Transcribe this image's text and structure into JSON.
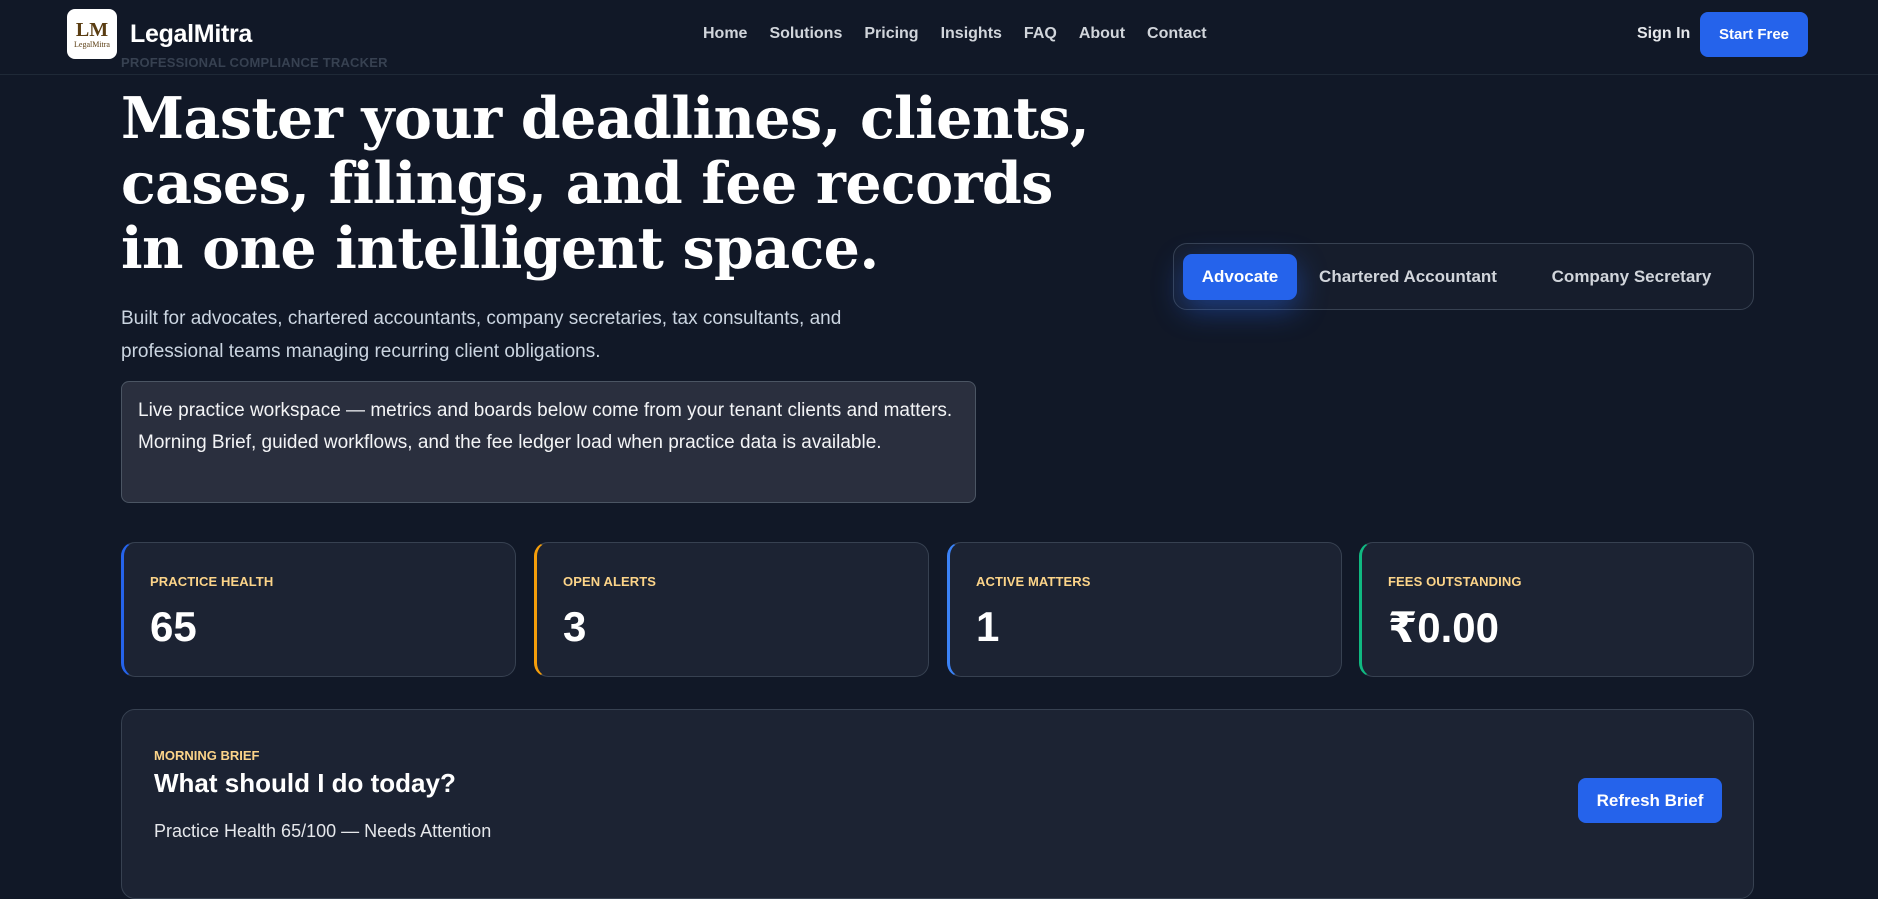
{
  "brand": {
    "name": "LegalMitra",
    "logo_mark": "LM",
    "logo_caption": "LegalMitra"
  },
  "nav": [
    "Home",
    "Solutions",
    "Pricing",
    "Insights",
    "FAQ",
    "About",
    "Contact"
  ],
  "auth": {
    "sign_in": "Sign In",
    "start": "Start Free"
  },
  "hero": {
    "eyebrow": "PROFESSIONAL COMPLIANCE TRACKER",
    "title": "Master your deadlines, clients, cases, filings, and fee records in one intelligent space.",
    "subtitle": "Built for advocates, chartered accountants, company secretaries, tax consultants, and professional teams managing recurring client obligations.",
    "notice": "Live practice workspace — metrics and boards below come from your tenant clients and matters. Morning Brief, guided workflows, and the fee ledger load when practice data is available."
  },
  "roles": {
    "active": "Advocate",
    "items": [
      "Advocate",
      "Chartered Accountant",
      "Company Secretary"
    ]
  },
  "stats": [
    {
      "label": "PRACTICE HEALTH",
      "value": "65",
      "accent": "#2563eb"
    },
    {
      "label": "OPEN ALERTS",
      "value": "3",
      "accent": "#f59e0b"
    },
    {
      "label": "ACTIVE MATTERS",
      "value": "1",
      "accent": "#3b82f6"
    },
    {
      "label": "FEES OUTSTANDING",
      "value": "₹0.00",
      "accent": "#10b981"
    }
  ],
  "brief": {
    "eyebrow": "MORNING BRIEF",
    "title": "What should I do today?",
    "status": "Practice Health 65/100 — Needs Attention",
    "refresh": "Refresh Brief"
  },
  "colors": {
    "background": "#111827",
    "primary": "#2563eb",
    "eyebrow": "#fcd489"
  }
}
